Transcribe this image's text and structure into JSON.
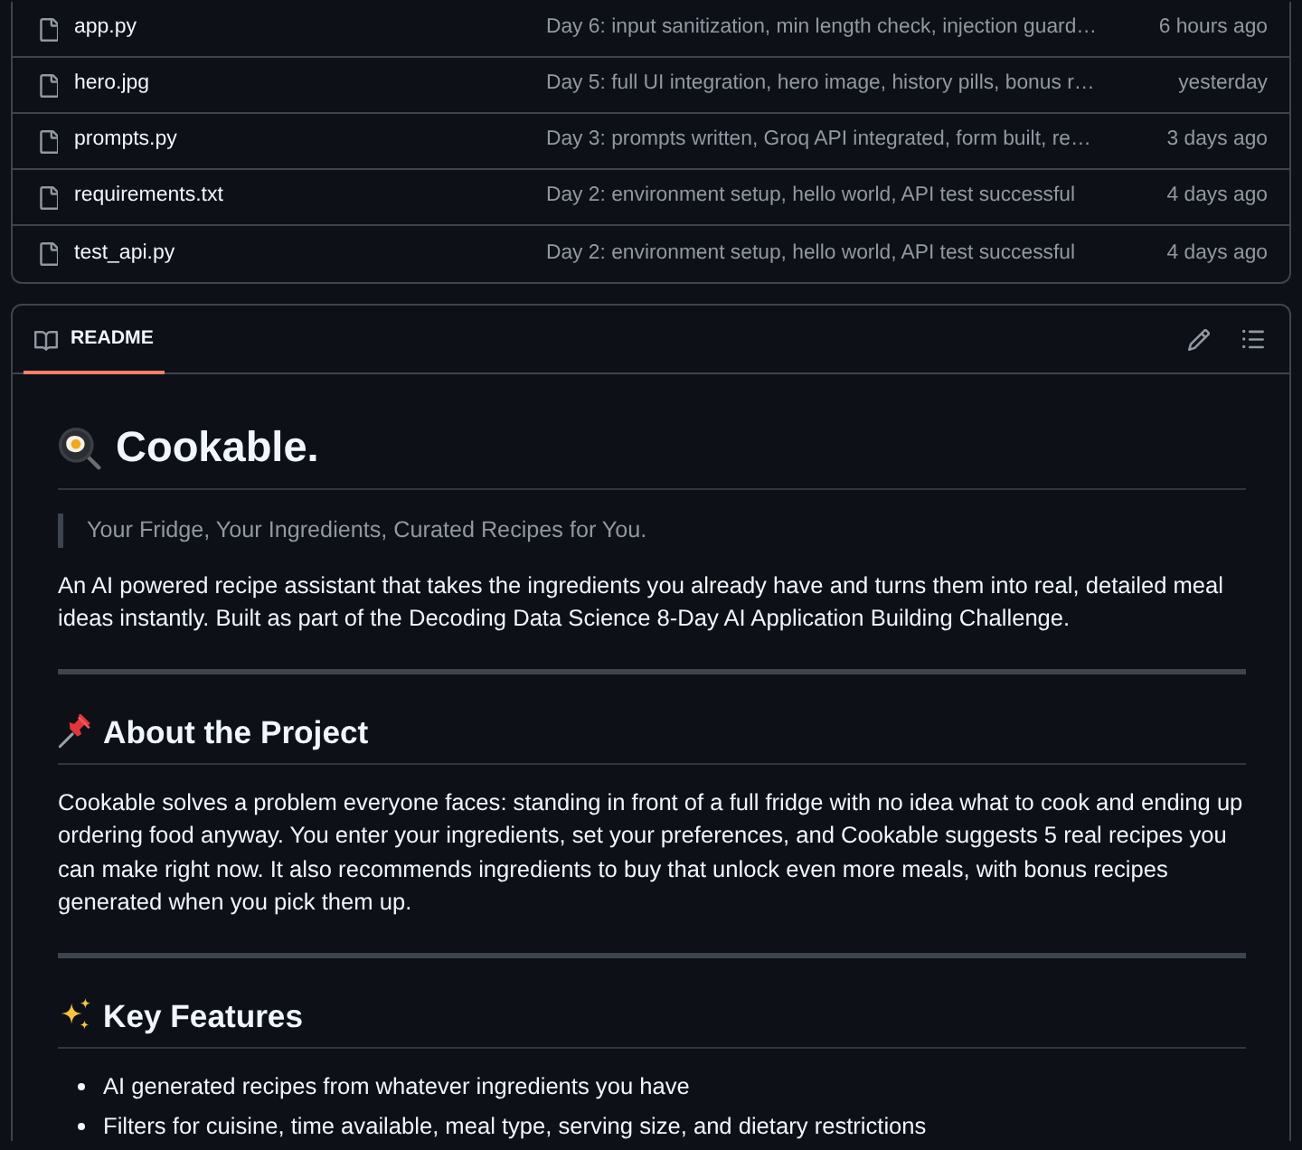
{
  "files": [
    {
      "name": "app.py",
      "message": "Day 6: input sanitization, min length check, injection guard…",
      "time": "6 hours ago"
    },
    {
      "name": "hero.jpg",
      "message": "Day 5: full UI integration, hero image, history pills, bonus r…",
      "time": "yesterday"
    },
    {
      "name": "prompts.py",
      "message": "Day 3: prompts written, Groq API integrated, form built, re…",
      "time": "3 days ago"
    },
    {
      "name": "requirements.txt",
      "message": "Day 2: environment setup, hello world, API test successful",
      "time": "4 days ago"
    },
    {
      "name": "test_api.py",
      "message": "Day 2: environment setup, hello world, API test successful",
      "time": "4 days ago"
    }
  ],
  "readme": {
    "tab": {
      "label": "README",
      "selected": true
    },
    "title": "Cookable.",
    "tagline": "Your Fridge, Your Ingredients, Curated Recipes for You.",
    "intro": "An AI powered recipe assistant that takes the ingredients you already have and turns them into real, detailed meal ideas instantly. Built as part of the Decoding Data Science 8-Day AI Application Building Challenge.",
    "sections": [
      {
        "heading": "About the Project",
        "kind": "paragraphs",
        "paragraphs": [
          "Cookable solves a problem everyone faces: standing in front of a full fridge with no idea what to cook and ending up ordering food anyway. You enter your ingredients, set your preferences, and Cookable suggests 5 real recipes you can make right now. It also recommends ingredients to buy that unlock even more meals, with bonus recipes generated when you pick them up."
        ]
      },
      {
        "heading": "Key Features",
        "kind": "bullets",
        "items": [
          "AI generated recipes from whatever ingredients you have",
          "Filters for cuisine, time available, meal type, serving size, and dietary restrictions"
        ]
      }
    ]
  }
}
